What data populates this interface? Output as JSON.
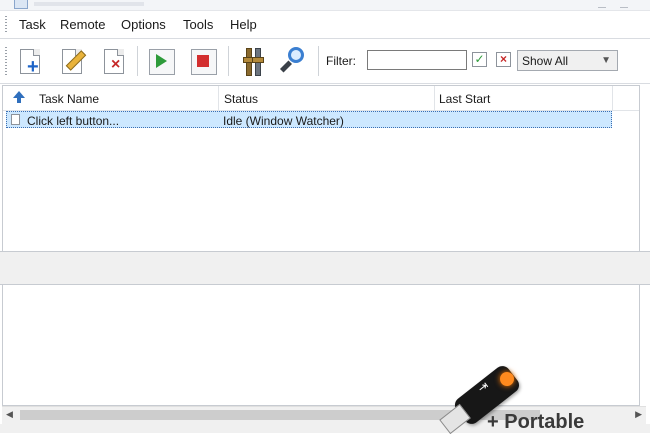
{
  "menu": [
    "Task",
    "Remote",
    "Options",
    "Tools",
    "Help"
  ],
  "toolbar": {
    "filter_label": "Filter:",
    "filter_value": "",
    "show_select": "Show All"
  },
  "columns": [
    "Task Name",
    "Status",
    "Last Start"
  ],
  "tasks": [
    {
      "name": "Click left button...",
      "status": "Idle (Window Watcher)",
      "last_start": ""
    }
  ],
  "watermark": "+ Portable",
  "colors": {
    "selection": "#cde8ff",
    "sort_arrow": "#2f6fbd",
    "run": "#2e9b3a",
    "stop": "#d32f2f",
    "usb_glow": "#ff8a1e"
  }
}
